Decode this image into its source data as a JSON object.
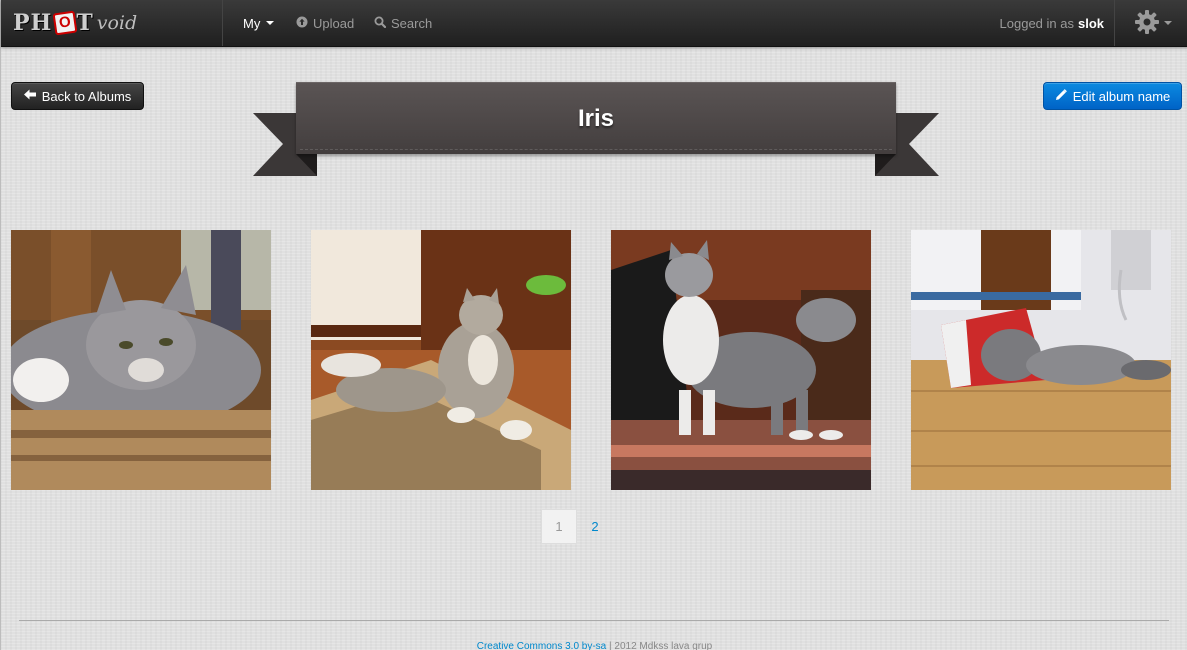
{
  "nav": {
    "brand_main": "PH",
    "brand_o": "O",
    "brand_rest": "T",
    "brand_suffix": "void",
    "my_label": "My",
    "upload_label": "Upload",
    "search_label": "Search",
    "logged_in_prefix": "Logged in as",
    "username": "slok"
  },
  "actions": {
    "back_label": "Back to Albums",
    "edit_label": "Edit album name"
  },
  "album": {
    "title": "Iris"
  },
  "photos": [
    {
      "name": "Cat lying on rug close-up"
    },
    {
      "name": "Cat sitting on patterned rug"
    },
    {
      "name": "Cat standing looking up"
    },
    {
      "name": "Cat inside beer box"
    }
  ],
  "pagination": {
    "pages": [
      "1",
      "2"
    ],
    "current": "1"
  },
  "footer": {
    "license_link": "Creative Commons 3.0 by-sa",
    "rest": "| 2012 Mdkss lava grup"
  },
  "colors": {
    "navbar": "#2b2b2b",
    "primary_button": "#0074cc",
    "ribbon": "#4e4848",
    "link": "#0088cc"
  }
}
